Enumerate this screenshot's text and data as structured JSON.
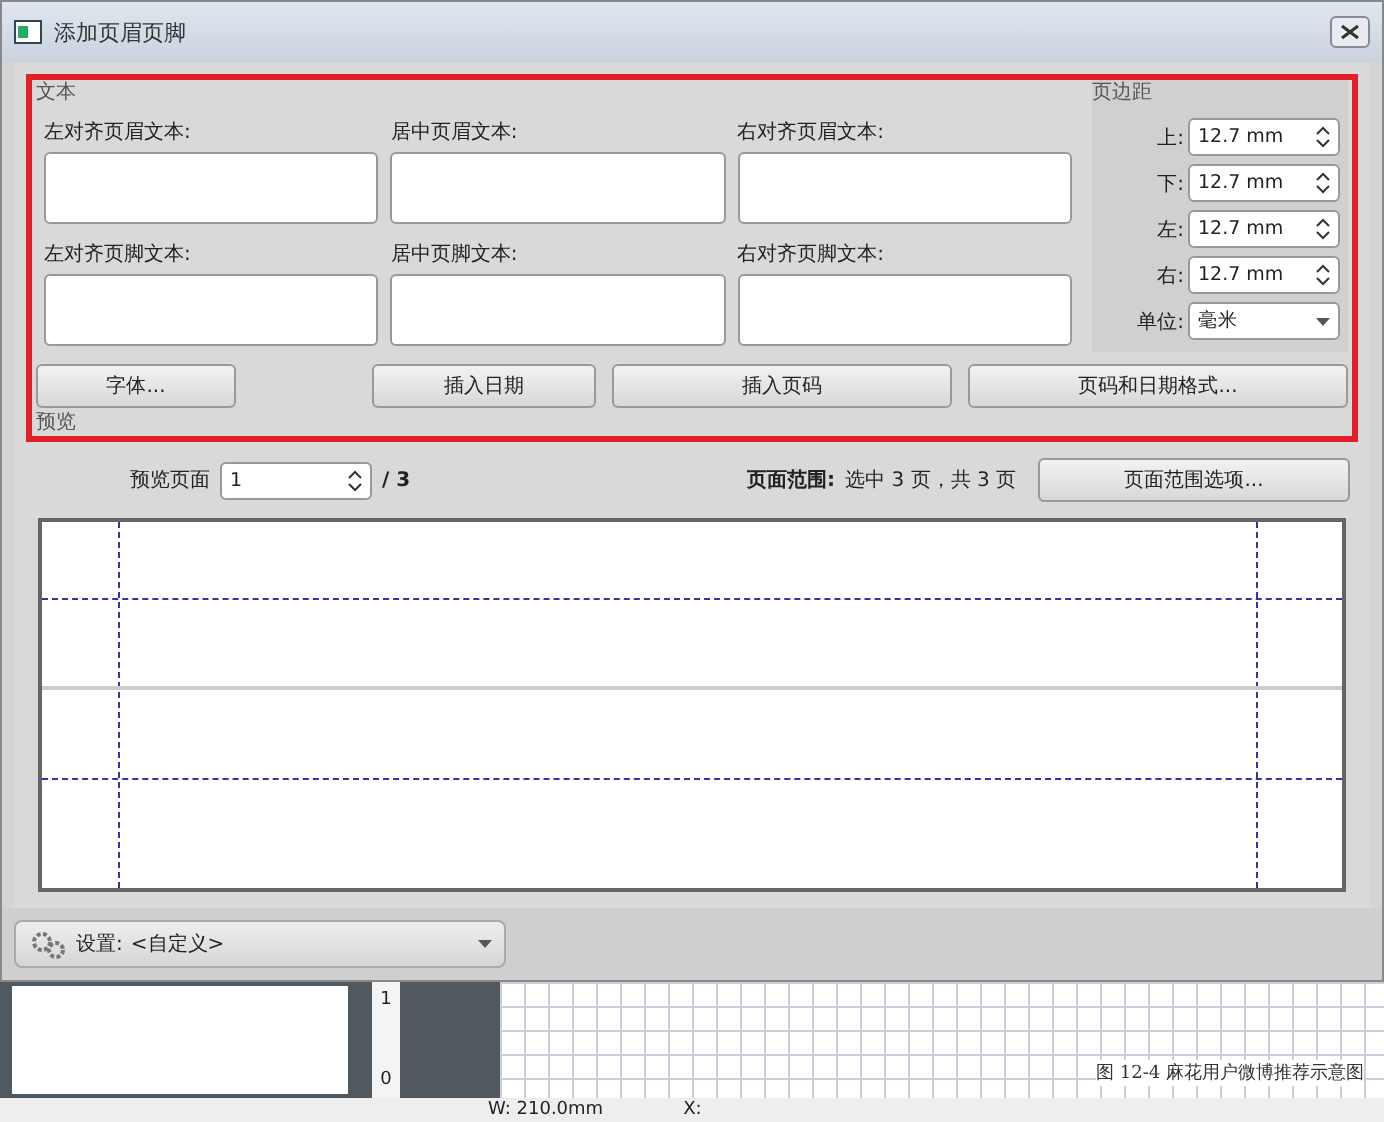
{
  "window": {
    "title": "添加页眉页脚"
  },
  "text_group": {
    "title": "文本",
    "fields": [
      {
        "label": "左对齐页眉文本:"
      },
      {
        "label": "居中页眉文本:"
      },
      {
        "label": "右对齐页眉文本:"
      },
      {
        "label": "左对齐页脚文本:"
      },
      {
        "label": "居中页脚文本:"
      },
      {
        "label": "右对齐页脚文本:"
      }
    ]
  },
  "margins": {
    "title": "页边距",
    "spinners": [
      {
        "label": "上:",
        "value": "12.7 mm"
      },
      {
        "label": "下:",
        "value": "12.7 mm"
      },
      {
        "label": "左:",
        "value": "12.7 mm"
      },
      {
        "label": "右:",
        "value": "12.7 mm"
      }
    ],
    "unit": {
      "label": "单位:",
      "value": "毫米"
    }
  },
  "buttons": [
    "字体...",
    "插入日期",
    "插入页码",
    "页码和日期格式..."
  ],
  "preview": {
    "title": "预览",
    "page_label": "预览页面",
    "page_value": "1",
    "page_total": "/ 3",
    "range_label": "页面范围:",
    "range_text": "选中 3 页，共 3 页",
    "range_button": "页面范围选项..."
  },
  "settings": {
    "label": "设置:",
    "value": "<自定义>"
  },
  "background": {
    "ruler_marks": [
      "1",
      "0"
    ],
    "width_label": "W: 210.0mm",
    "x_label": "X:",
    "caption": "图 12-4  麻花用户微博推荐示意图"
  }
}
